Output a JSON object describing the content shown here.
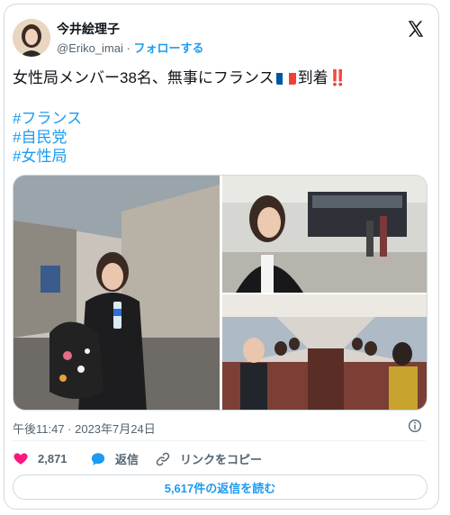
{
  "author": {
    "display_name": "今井絵理子",
    "handle": "@Eriko_imai",
    "separator": "·",
    "follow_label": "フォローする"
  },
  "tweet": {
    "text_before_flag": "女性局メンバー38名、無事にフランス",
    "text_after_flag": "到着",
    "emphasis": "‼️",
    "hashtags": [
      "#フランス",
      "#自民党",
      "#女性局"
    ]
  },
  "flag_colors": [
    "#0055A4",
    "#FFFFFF",
    "#EF4135"
  ],
  "accent_color": "#1d9bf0",
  "like_color": "#f91880",
  "timestamp": "午後11:47 · 2023年7月24日",
  "actions": {
    "like_count": "2,871",
    "reply_label": "返信",
    "copy_link_label": "リンクをコピー"
  },
  "read_replies_label": "5,617件の返信を読む",
  "icons": {
    "logo": "x-logo-icon",
    "info": "info-icon",
    "like": "heart-icon",
    "reply": "speech-bubble-icon",
    "link": "link-icon"
  }
}
